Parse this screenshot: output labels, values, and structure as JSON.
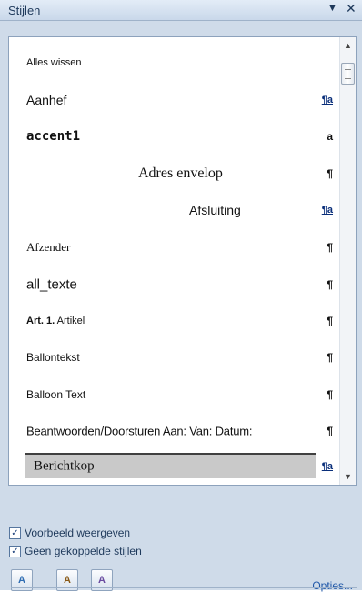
{
  "panel": {
    "title": "Stijlen",
    "dropdown_glyph": "▼",
    "close_glyph": "✕"
  },
  "styles": [
    {
      "label": "Alles wissen",
      "mark": ""
    },
    {
      "label": "Aanhef",
      "mark": "¶a"
    },
    {
      "label": "accent1",
      "mark": "a"
    },
    {
      "label": "Adres envelop",
      "mark": "¶"
    },
    {
      "label": "Afsluiting",
      "mark": "¶a"
    },
    {
      "label": "Afzender",
      "mark": "¶"
    },
    {
      "label": "all_texte",
      "mark": "¶"
    },
    {
      "label_bold": "Art. 1.",
      "label_rest": "Artikel",
      "mark": "¶"
    },
    {
      "label": "Ballontekst",
      "mark": "¶"
    },
    {
      "label": "Balloon Text",
      "mark": "¶"
    },
    {
      "label": "Beantwoorden/Doorsturen Aan: Van: Datum:",
      "mark": "¶"
    },
    {
      "label": "Berichtkop",
      "mark": "¶a"
    }
  ],
  "options": {
    "preview": {
      "label": "Voorbeeld weergeven",
      "checked": true
    },
    "linked": {
      "label": "Geen gekoppelde stijlen",
      "checked": true
    }
  },
  "buttons": {
    "new_style": "A",
    "inspect": "A",
    "manage": "A"
  },
  "links": {
    "options": "Opties..."
  },
  "icons": {
    "check": "✓",
    "scroll_up": "▲",
    "scroll_down": "▼"
  }
}
